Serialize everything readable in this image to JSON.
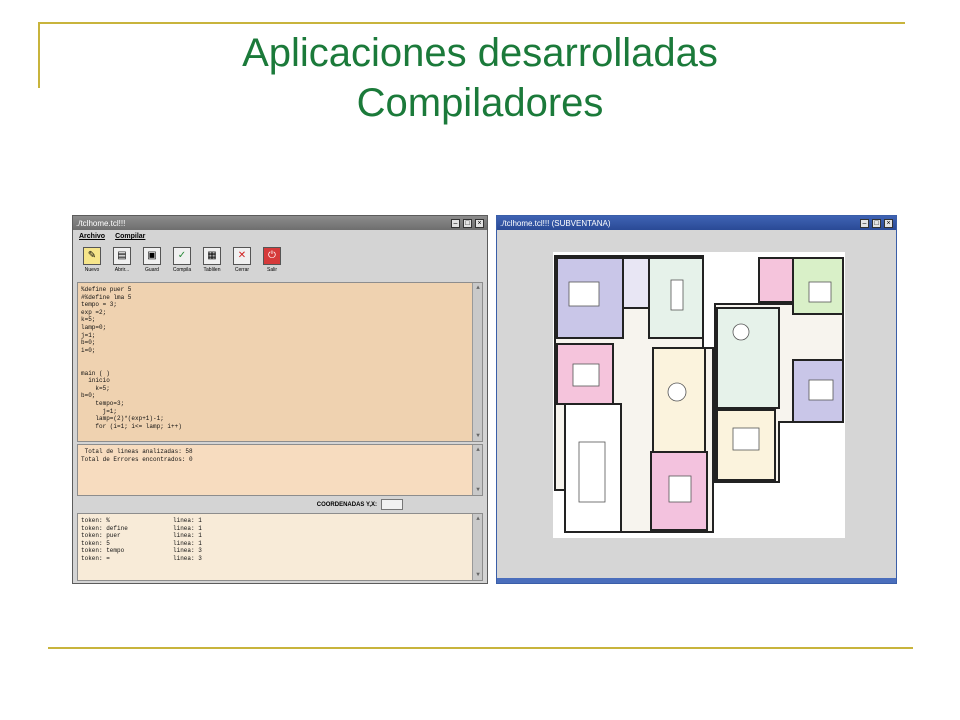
{
  "slide": {
    "title_line1": "Aplicaciones desarrolladas",
    "title_line2": "Compiladores"
  },
  "colors": {
    "title": "#1b7a3a",
    "rule": "#c8b43c"
  },
  "left_window": {
    "title": "./tclhome.tcl!!!",
    "menu": [
      "Archivo",
      "Compilar"
    ],
    "toolbar": [
      {
        "label": "Nuevo",
        "icon": "new-doc-icon"
      },
      {
        "label": "Abrir...",
        "icon": "open-icon"
      },
      {
        "label": "Guard",
        "icon": "save-icon"
      },
      {
        "label": "Compila",
        "icon": "compile-icon"
      },
      {
        "label": "Tablilen",
        "icon": "table-icon"
      },
      {
        "label": "Cerrar",
        "icon": "close-x-icon"
      },
      {
        "label": "Salir",
        "icon": "exit-icon"
      }
    ],
    "code_lines": [
      "%define puer 5",
      "#%define lma 5",
      "tempo = 3;",
      "exp =2;",
      "k=5;",
      "lamp=0;",
      "j=1;",
      "b=0;",
      "i=0;",
      "",
      "",
      "main ( )",
      "  inicio",
      "    k=5;",
      "b=0;",
      "    tempo=3;",
      "      j=1;",
      "    lamp=(2)*(exp+1)-1;",
      "    for (i=1; i<= lamp; i++)"
    ],
    "summary_lines": [
      " Total de lineas analizadas: 58",
      "Total de Errores encontrados: 0"
    ],
    "coord_label": "COORDENADAS Y,X:",
    "tokens": [
      {
        "token": "token: %",
        "line": "linea: 1"
      },
      {
        "token": "token: define",
        "line": "linea: 1"
      },
      {
        "token": "token: puer",
        "line": "linea: 1"
      },
      {
        "token": "token: 5",
        "line": "linea: 1"
      },
      {
        "token": "token: tempo",
        "line": "linea: 3"
      },
      {
        "token": "token: =",
        "line": "linea: 3"
      }
    ]
  },
  "right_window": {
    "title": "./tclhome.tcl!!! (SUBVENTANA)"
  }
}
